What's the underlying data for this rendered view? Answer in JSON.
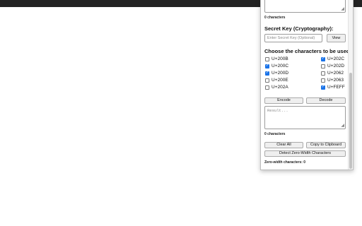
{
  "top_textarea": {
    "counter": "0 characters"
  },
  "secret_key": {
    "title": "Secret Key (Cryptography):",
    "placeholder": "Enter Secret Key (Optional)",
    "view_label": "View"
  },
  "characters": {
    "title": "Choose the characters to be used:",
    "left_column": [
      {
        "label": "U+200B",
        "checked": false
      },
      {
        "label": "U+200C",
        "checked": true
      },
      {
        "label": "U+200D",
        "checked": true
      },
      {
        "label": "U+200E",
        "checked": false
      },
      {
        "label": "U+202A",
        "checked": false
      }
    ],
    "right_column": [
      {
        "label": "U+202C",
        "checked": true
      },
      {
        "label": "U+202D",
        "checked": false
      },
      {
        "label": "U+2062",
        "checked": false
      },
      {
        "label": "U+2063",
        "checked": false
      },
      {
        "label": "U+FEFF",
        "checked": true
      }
    ]
  },
  "actions": {
    "encode_label": "Encode",
    "decode_label": "Decode"
  },
  "result": {
    "placeholder": "Result...",
    "counter": "0 characters"
  },
  "buttons": {
    "clear_label": "Clear All",
    "copy_label": "Copy to Clipboard",
    "detect_label": "Detect Zero-Width Characters"
  },
  "status": {
    "zero_width_count": "Zero-width characters: 0"
  },
  "colors": {
    "checkbox_accent": "#1a73e8",
    "top_bar": "#232323"
  }
}
